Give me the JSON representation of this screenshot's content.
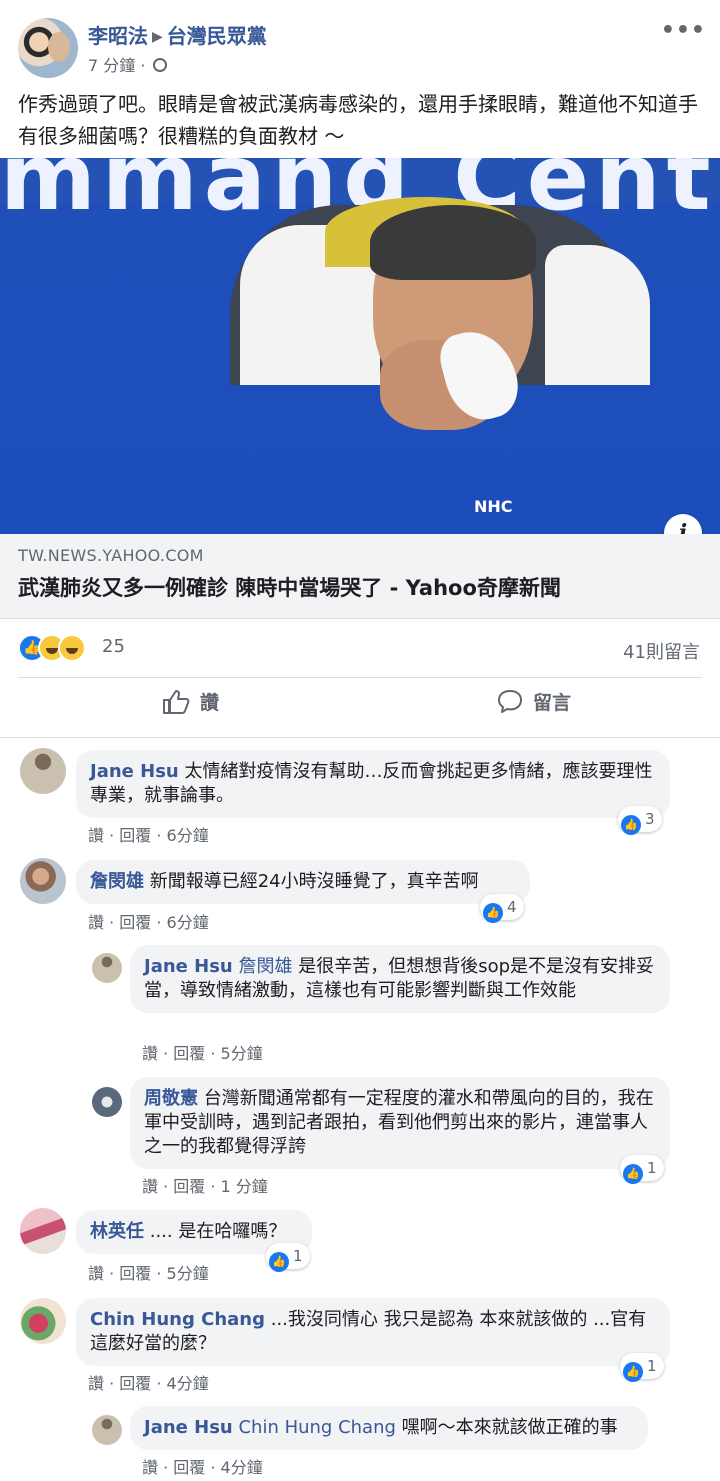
{
  "post": {
    "author": "李昭法",
    "group": "台灣民眾黨",
    "time": "7 分鐘 ·",
    "text": "作秀過頭了吧。眼睛是會被武漢病毒感染的，還用手揉眼睛，難道他不知道手有很多細菌嗎？很糟糕的負面教材 ～"
  },
  "link": {
    "banner_text": "mmand Center",
    "vest_text": "NHC",
    "domain": "TW.NEWS.YAHOO.COM",
    "title": "武漢肺炎又多一例確診 陳時中當場哭了 - Yahoo奇摩新聞"
  },
  "reactions": {
    "count": "25",
    "comments": "41則留言"
  },
  "actions": {
    "like": "讚",
    "comment": "留言"
  },
  "comments": [
    {
      "name": "Jane Hsu",
      "text": "太情緒對疫情沒有幫助…反而會挑起更多情緒，應該要理性專業，就事論事。",
      "meta": "讚 · 回覆 · 6分鐘",
      "likes": "3"
    },
    {
      "name": "詹閔雄",
      "text": "新聞報導已經24小時沒睡覺了，真辛苦啊",
      "meta": "讚 · 回覆 · 6分鐘",
      "likes": "4"
    },
    {
      "name": "Jane Hsu",
      "mention": "詹閔雄",
      "text": "是很辛苦，但想想背後sop是不是沒有安排妥當，導致情緒激動，這樣也有可能影響判斷與工作效能",
      "meta": "讚 · 回覆 · 5分鐘"
    },
    {
      "name": "周敬憲",
      "text": "台灣新聞通常都有一定程度的灌水和帶風向的目的，我在軍中受訓時，遇到記者跟拍，看到他們剪出來的影片，連當事人之一的我都覺得浮誇",
      "meta": "讚 · 回覆 · 1 分鐘",
      "likes": "1"
    },
    {
      "name": "林英任",
      "text": ".... 是在哈囉嗎？",
      "meta": "讚 · 回覆 · 5分鐘",
      "likes": "1"
    },
    {
      "name": "Chin Hung Chang",
      "text": "...我沒同情心 我只是認為 本來就該做的 ...官有這麼好當的麼？",
      "meta": "讚 · 回覆 · 4分鐘",
      "likes": "1"
    },
    {
      "name": "Jane Hsu",
      "mention": "Chin Hung Chang",
      "text": "嘿啊～本來就該做正確的事",
      "meta": "讚 · 回覆 · 4分鐘"
    }
  ],
  "colors": {
    "accent": "#385898",
    "like_blue": "#1877f2",
    "bubble": "#f2f3f5",
    "banner_blue": "#2453b5"
  }
}
